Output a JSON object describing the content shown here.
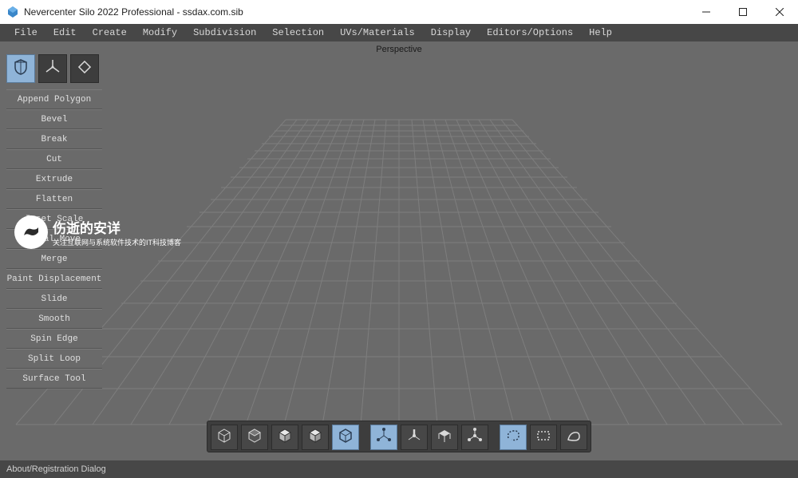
{
  "window": {
    "title": "Nevercenter Silo 2022 Professional - ssdax.com.sib"
  },
  "menu": {
    "items": [
      "File",
      "Edit",
      "Create",
      "Modify",
      "Subdivision",
      "Selection",
      "UVs/Materials",
      "Display",
      "Editors/Options",
      "Help"
    ]
  },
  "viewport": {
    "label": "Perspective"
  },
  "modes": {
    "items": [
      {
        "name": "select-mode",
        "icon": "shield",
        "active": true
      },
      {
        "name": "move-mode",
        "icon": "axes",
        "active": false
      },
      {
        "name": "rotate-mode",
        "icon": "diamond",
        "active": false
      }
    ]
  },
  "tools": {
    "items": [
      "Append Polygon",
      "Bevel",
      "Break",
      "Cut",
      "Extrude",
      "Flatten",
      "Inset Scale",
      "Local Move",
      "Merge",
      "Paint Displacement",
      "Slide",
      "Smooth",
      "Spin Edge",
      "Split Loop",
      "Surface Tool"
    ]
  },
  "watermark": {
    "line1": "伤逝的安详",
    "line2": "关注互联网与系统软件技术的IT科技博客"
  },
  "bottom_toolbar": {
    "groups": [
      [
        {
          "name": "shade-1",
          "icon": "cube-wire",
          "active": false
        },
        {
          "name": "shade-2",
          "icon": "cube-dark",
          "active": false
        },
        {
          "name": "shade-3",
          "icon": "cube-solid",
          "active": false
        },
        {
          "name": "shade-4",
          "icon": "cube-solid2",
          "active": false
        },
        {
          "name": "shade-5",
          "icon": "cube-outline",
          "active": true
        }
      ],
      [
        {
          "name": "sel-vertex",
          "icon": "sel-vertex",
          "active": true
        },
        {
          "name": "sel-edge",
          "icon": "sel-edge",
          "active": false
        },
        {
          "name": "sel-face",
          "icon": "sel-face",
          "active": false
        },
        {
          "name": "sel-object",
          "icon": "sel-object",
          "active": false
        }
      ],
      [
        {
          "name": "lasso",
          "icon": "lasso",
          "active": true
        },
        {
          "name": "marquee",
          "icon": "marquee",
          "active": false
        },
        {
          "name": "paint-sel",
          "icon": "paint",
          "active": false
        }
      ]
    ]
  },
  "statusbar": {
    "text": "About/Registration Dialog"
  }
}
